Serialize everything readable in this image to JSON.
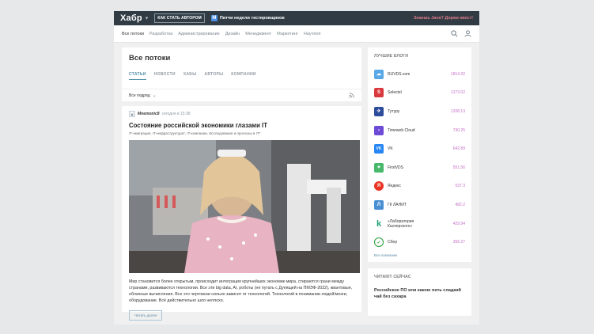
{
  "header": {
    "logo": "Хабр",
    "author_button": "КАК СТАТЬ АВТОРОМ",
    "promo_badge": "M",
    "promo_text": "Питчи недели тестировщиков",
    "java_link": "Знаешь Java? Дорви квест!"
  },
  "nav": {
    "items": [
      "Все потоки",
      "Разработка",
      "Администрирование",
      "Дизайн",
      "Менеджмент",
      "Маркетинг",
      "Научпоп"
    ]
  },
  "feed": {
    "title": "Все потоки",
    "tabs": [
      "СТАТЬИ",
      "НОВОСТИ",
      "ХАБЫ",
      "АВТОРЫ",
      "КОМПАНИИ"
    ],
    "filter": "Все подряд"
  },
  "article": {
    "author": "Mnemonic8",
    "time": "сегодня в 15:38",
    "title": "Состояние российской экономики глазами IT",
    "hubs": "IT-эмиграция, IT-инфраструктура*, IT-компании, Исследования и прогнозы в IT*",
    "excerpt": "Мир становится более открытым, происходит интеграция крупнейших экономик мира, стираются грани между странами, развиваются технологии. Все эти big data, AI, роботы (не путать с Дунящей на ПМЭФ-2022), квантовые, облачные вычисления. Все это чертовски сильно зависит от технологий. Технологий в понимании людей/мозги, оборудование. Всё действительно шло неплохо.",
    "read_more": "Читать далее"
  },
  "blogs": {
    "title": "ЛУЧШИЕ БЛОГИ",
    "items": [
      {
        "name": "RUVDS.com",
        "rating": "1814.32",
        "icon": "☁",
        "color": "#5aa9e6"
      },
      {
        "name": "Selectel",
        "rating": "1273.02",
        "icon": "S",
        "color": "#d9393e"
      },
      {
        "name": "Тутуру",
        "rating": "1208.13",
        "icon": "✈",
        "color": "#2d4d9b"
      },
      {
        "name": "Timeweb Cloud",
        "rating": "730.25",
        "icon": "›",
        "color": "#6d4bd6"
      },
      {
        "name": "VK",
        "rating": "642.89",
        "icon": "VK",
        "color": "#2787f5"
      },
      {
        "name": "FirstVDS",
        "rating": "551.56",
        "icon": "✦",
        "color": "#48b86b"
      },
      {
        "name": "Яндекс",
        "rating": "537.3",
        "icon": "Я",
        "color": "#ea3423"
      },
      {
        "name": "ГК ЛАНИТ",
        "rating": "482.2",
        "icon": "Л",
        "color": "#4a8fd4"
      },
      {
        "name": "«Лаборатория Касперского»",
        "rating": "429.94",
        "icon": "k",
        "color": "#ffffff"
      },
      {
        "name": "Сбер",
        "rating": "356.27",
        "icon": "✓",
        "color": "#ffffff"
      }
    ],
    "all_link": "Все компании"
  },
  "reading_now": {
    "title": "ЧИТАЮТ СЕЙЧАС",
    "item": "Российское ПО или какою пить сладкий чай без сахара"
  }
}
